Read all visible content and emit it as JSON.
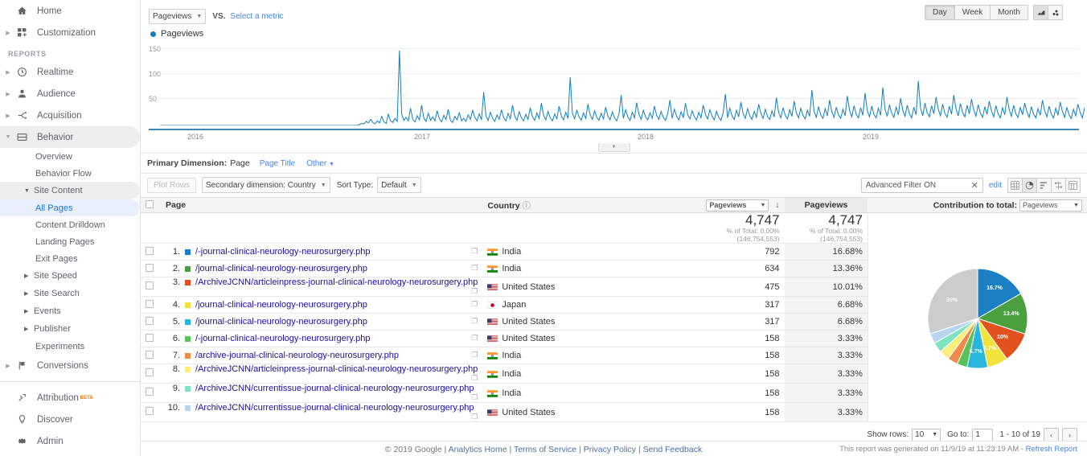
{
  "sidebar": {
    "home": "Home",
    "customization": "Customization",
    "reports_label": "REPORTS",
    "items": [
      {
        "label": "Realtime",
        "icon": "clock-icon"
      },
      {
        "label": "Audience",
        "icon": "person-icon"
      },
      {
        "label": "Acquisition",
        "icon": "acquisition-icon"
      },
      {
        "label": "Behavior",
        "icon": "behavior-icon"
      },
      {
        "label": "Conversions",
        "icon": "flag-icon"
      }
    ],
    "behavior_children": [
      "Overview",
      "Behavior Flow"
    ],
    "site_content": "Site Content",
    "site_content_children": [
      "All Pages",
      "Content Drilldown",
      "Landing Pages",
      "Exit Pages"
    ],
    "site_content_selected": "All Pages",
    "behavior_groups": [
      "Site Speed",
      "Site Search",
      "Events",
      "Publisher"
    ],
    "experiments": "Experiments",
    "bottom": [
      {
        "label": "Attribution",
        "badge": "BETA",
        "icon": "attribution-icon"
      },
      {
        "label": "Discover",
        "badge": "",
        "icon": "bulb-icon"
      },
      {
        "label": "Admin",
        "badge": "",
        "icon": "gear-icon"
      }
    ]
  },
  "metricbar": {
    "metric": "Pageviews",
    "vs": "VS.",
    "select_metric": "Select a metric",
    "granularity": [
      "Day",
      "Week",
      "Month"
    ],
    "granularity_selected": "Day",
    "chart_icons": [
      "line-chart-icon",
      "scatter-chart-icon"
    ]
  },
  "chart_data": {
    "type": "line",
    "title": "Pageviews",
    "legend": [
      "Pageviews"
    ],
    "series_color": "#0f7fc1",
    "ylabel": "",
    "xlabel": "",
    "yticks": [
      150,
      100,
      50
    ],
    "ylim": [
      0,
      165
    ],
    "xticks": [
      "2016",
      "2017",
      "2018",
      "2019"
    ],
    "grid": true,
    "note": "Daily pageviews: flat near zero from 2016 to early 2018, then volatile spiky activity peaking near 150.",
    "values": [
      0,
      0,
      0,
      0,
      0,
      0,
      0,
      0,
      0,
      0,
      0,
      0,
      0,
      0,
      0,
      0,
      0,
      0,
      0,
      0,
      0,
      0,
      0,
      0,
      0,
      0,
      0,
      0,
      0,
      0,
      0,
      0,
      0,
      0,
      0,
      0,
      0,
      0,
      0,
      0,
      0,
      0,
      0,
      0,
      0,
      0,
      0,
      0,
      0,
      0,
      0,
      0,
      0,
      0,
      0,
      0,
      0,
      0,
      0,
      0,
      0,
      0,
      0,
      0,
      0,
      0,
      0,
      0,
      0,
      0,
      0,
      0,
      0,
      0,
      0,
      0,
      0,
      0,
      0,
      0,
      0,
      0,
      0,
      0,
      0,
      0,
      0,
      0,
      0,
      0,
      2,
      4,
      3,
      8,
      5,
      12,
      6,
      3,
      9,
      5,
      18,
      7,
      4,
      22,
      9,
      6,
      14,
      8,
      148,
      22,
      10,
      16,
      9,
      34,
      12,
      7,
      19,
      11,
      40,
      14,
      8,
      24,
      10,
      17,
      9,
      29,
      13,
      7,
      20,
      12,
      32,
      10,
      6,
      18,
      11,
      25,
      9,
      14,
      8,
      21,
      12,
      30,
      16,
      9,
      23,
      11,
      66,
      19,
      10,
      26,
      14,
      8,
      21,
      12,
      31,
      15,
      9,
      24,
      13,
      40,
      18,
      10,
      27,
      15,
      9,
      22,
      12,
      35,
      17,
      10,
      25,
      14,
      44,
      20,
      11,
      28,
      15,
      9,
      23,
      13,
      38,
      19,
      11,
      26,
      14,
      95,
      24,
      13,
      30,
      17,
      10,
      25,
      14,
      42,
      21,
      12,
      29,
      16,
      10,
      24,
      13,
      36,
      19,
      11,
      27,
      15,
      9,
      23,
      60,
      14,
      31,
      17,
      10,
      26,
      15,
      45,
      22,
      12,
      30,
      17,
      11,
      25,
      14,
      38,
      20,
      12,
      28,
      16,
      10,
      24,
      50,
      14,
      32,
      18,
      11,
      27,
      15,
      44,
      21,
      13,
      29,
      17,
      11,
      26,
      15,
      40,
      22,
      13,
      31,
      18,
      11,
      28,
      16,
      10,
      25,
      62,
      15,
      34,
      19,
      12,
      30,
      17,
      46,
      23,
      14,
      33,
      19,
      12,
      28,
      16,
      42,
      24,
      14,
      32,
      18,
      12,
      29,
      17,
      55,
      26,
      15,
      35,
      20,
      13,
      31,
      18,
      48,
      25,
      15,
      34,
      20,
      13,
      30,
      18,
      70,
      28,
      16,
      37,
      21,
      14,
      33,
      19,
      50,
      27,
      16,
      36,
      21,
      14,
      32,
      19,
      58,
      30,
      17,
      39,
      22,
      15,
      35,
      20,
      64,
      29,
      17,
      38,
      22,
      15,
      34,
      20,
      75,
      32,
      18,
      41,
      24,
      16,
      37,
      21,
      54,
      30,
      18,
      40,
      23,
      15,
      36,
      21,
      88,
      34,
      19,
      44,
      25,
      17,
      39,
      23,
      56,
      32,
      19,
      42,
      24,
      16,
      38,
      22,
      60,
      33,
      19,
      43,
      25,
      17,
      40,
      23,
      52,
      31,
      18,
      41,
      24,
      16,
      37,
      22,
      48,
      29,
      17,
      39,
      23,
      15,
      35,
      21,
      56,
      31,
      18,
      40,
      23,
      16,
      36,
      21,
      44,
      27,
      16,
      37,
      22,
      15,
      33,
      20,
      50,
      29,
      17,
      38,
      22,
      15,
      34,
      20,
      46,
      28,
      16,
      36,
      21,
      14,
      32,
      19,
      42,
      26,
      15,
      35
    ]
  },
  "dimensions": {
    "primary_label": "Primary Dimension:",
    "primary_current": "Page",
    "alt_links": [
      "Page Title"
    ],
    "other": "Other",
    "plot_rows": "Plot Rows",
    "secondary_dimension": "Secondary dimension: Country",
    "sort_type_label": "Sort Type:",
    "sort_type_value": "Default",
    "filter_text": "Advanced Filter ON",
    "edit_link": "edit",
    "view_icons": [
      "table-view-icon",
      "pie-view-icon",
      "performance-view-icon",
      "comparison-view-icon",
      "pivot-view-icon"
    ],
    "view_selected": "pie-view-icon"
  },
  "table": {
    "headers": {
      "page": "Page",
      "country": "Country",
      "metric_select": "Pageviews",
      "pageviews": "Pageviews",
      "contribution_label": "Contribution to total:",
      "contribution_value": "Pageviews"
    },
    "summary": {
      "pageviews_total": "4,747",
      "pageviews_pct_label": "% of Total: 0.00%",
      "pageviews_total_all": "(146,754,553)",
      "pct_total": "4,747",
      "pct_pct_label": "% of Total: 0.00%",
      "pct_total_all": "(146,754,553)"
    },
    "rows": [
      {
        "index": "1.",
        "color": "#1b7fc4",
        "page": "/-journal-clinical-neurology-neurosurgery.php",
        "country": "India",
        "flag": "in",
        "pageviews": "792",
        "percent": "16.68%"
      },
      {
        "index": "2.",
        "color": "#4aa03f",
        "page": "/journal-clinical-neurology-neurosurgery.php",
        "country": "India",
        "flag": "in",
        "pageviews": "634",
        "percent": "13.36%"
      },
      {
        "index": "3.",
        "color": "#e1521f",
        "page": "/ArchiveJCNN/articleinpress-journal-clinical-neurology-neurosurgery.php",
        "country": "United States",
        "flag": "us",
        "pageviews": "475",
        "percent": "10.01%"
      },
      {
        "index": "4.",
        "color": "#f2e33c",
        "page": "/journal-clinical-neurology-neurosurgery.php",
        "country": "Japan",
        "flag": "jp",
        "pageviews": "317",
        "percent": "6.68%"
      },
      {
        "index": "5.",
        "color": "#29b6dd",
        "page": "/journal-clinical-neurology-neurosurgery.php",
        "country": "United States",
        "flag": "us",
        "pageviews": "317",
        "percent": "6.68%"
      },
      {
        "index": "6.",
        "color": "#57c45a",
        "page": "/-journal-clinical-neurology-neurosurgery.php",
        "country": "United States",
        "flag": "us",
        "pageviews": "158",
        "percent": "3.33%"
      },
      {
        "index": "7.",
        "color": "#f08a4b",
        "page": "/archive-journal-clinical-neurology-neurosurgery.php",
        "country": "India",
        "flag": "in",
        "pageviews": "158",
        "percent": "3.33%"
      },
      {
        "index": "8.",
        "color": "#f7ef7a",
        "page": "/ArchiveJCNN/articleinpress-journal-clinical-neurology-neurosurgery.php",
        "country": "India",
        "flag": "in",
        "pageviews": "158",
        "percent": "3.33%"
      },
      {
        "index": "9.",
        "color": "#7fe3c0",
        "page": "/ArchiveJCNN/currentissue-journal-clinical-neurology-neurosurgery.php",
        "country": "India",
        "flag": "in",
        "pageviews": "158",
        "percent": "3.33%"
      },
      {
        "index": "10.",
        "color": "#b9d4ee",
        "page": "/ArchiveJCNN/currentissue-journal-clinical-neurology-neurosurgery.php",
        "country": "United States",
        "flag": "us",
        "pageviews": "158",
        "percent": "3.33%"
      }
    ]
  },
  "pie_chart": {
    "type": "pie",
    "labels": [
      "16.7%",
      "13.4%",
      "10%",
      "6.7%",
      "6.7%",
      "",
      "",
      "",
      "",
      "",
      "30%"
    ],
    "values": [
      16.7,
      13.4,
      10.0,
      6.7,
      6.7,
      3.33,
      3.33,
      3.33,
      3.33,
      3.33,
      30.0
    ],
    "colors": [
      "#1b7fc4",
      "#4aa03f",
      "#e1521f",
      "#f2e33c",
      "#29b6dd",
      "#57c45a",
      "#f08a4b",
      "#f7ef7a",
      "#7fe3c0",
      "#b9d4ee",
      "#cccccc"
    ],
    "visible_labels": [
      {
        "text": "16.7%",
        "slice": 0
      },
      {
        "text": "13.4%",
        "slice": 1
      },
      {
        "text": "10%",
        "slice": 2
      },
      {
        "text": "6.7%",
        "slice": 3
      },
      {
        "text": "6.7%",
        "slice": 4
      },
      {
        "text": "30%",
        "slice": 10
      }
    ]
  },
  "pagination": {
    "show_rows_label": "Show rows:",
    "show_rows_value": "10",
    "goto_label": "Go to:",
    "goto_value": "1",
    "range": "1 - 10 of 19",
    "prev": "‹",
    "next": "›"
  },
  "generated": {
    "text": "This report was generated on 11/9/19 at 11:23:19 AM -",
    "refresh": "Refresh Report"
  },
  "footer": {
    "copyright": "© 2019 Google",
    "links": [
      "Analytics Home",
      "Terms of Service",
      "Privacy Policy",
      "Send Feedback"
    ]
  }
}
